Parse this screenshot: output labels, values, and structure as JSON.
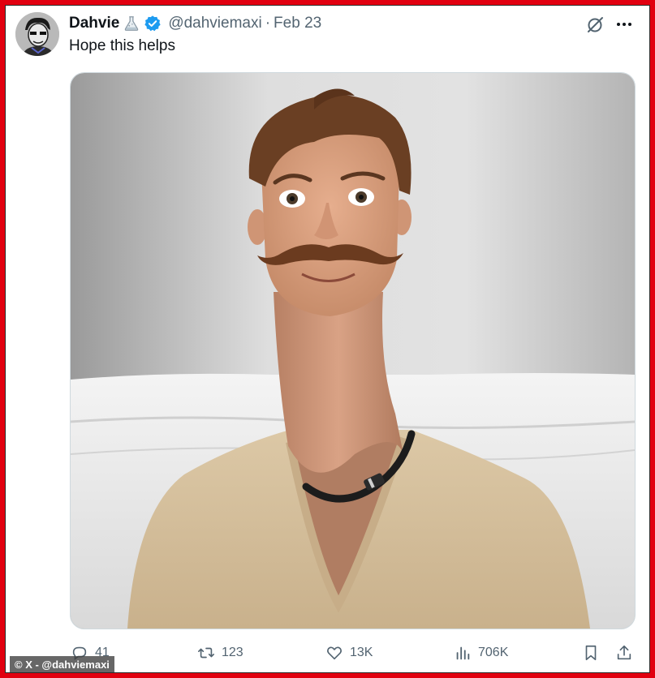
{
  "tweet": {
    "author_name": "Dahvie",
    "handle": "@dahviemaxi",
    "separator": "·",
    "date": "Feb 23",
    "text": "Hope this helps"
  },
  "icons": {
    "avatar": "avatar",
    "badge_emoji": "flask-icon",
    "verified": "verified-badge-icon",
    "grok": "grok-icon",
    "more": "more-icon",
    "reply": "reply-icon",
    "retweet": "retweet-icon",
    "like": "like-icon",
    "views": "views-icon",
    "bookmark": "bookmark-icon",
    "share": "share-icon"
  },
  "actions": {
    "replies": "41",
    "retweets": "123",
    "likes": "13K",
    "views": "706K"
  },
  "watermark": "© X - @dahviemaxi",
  "colors": {
    "frame_border": "#e1000f",
    "verified": "#1d9bf0",
    "secondary_text": "#536471",
    "primary_text": "#0f1419"
  }
}
